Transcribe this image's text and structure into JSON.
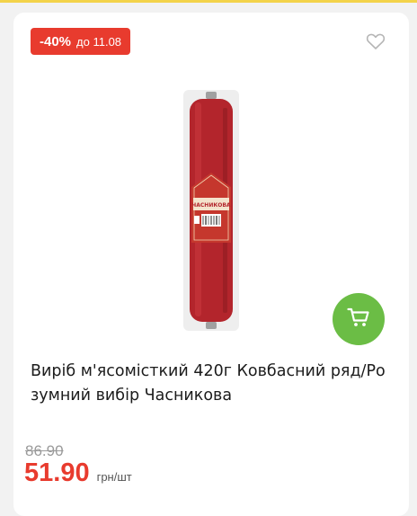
{
  "badge": {
    "discount": "-40%",
    "until": "до 11.08"
  },
  "icons": {
    "favorite": "heart-outline-icon",
    "cart": "cart-icon"
  },
  "product": {
    "title": "Виріб м'ясомісткий 420г Ковбасний ряд/Розумний вибір Часникова",
    "label_text": "ЧАСНИКОВА"
  },
  "price": {
    "old": "86.90",
    "current": "51.90",
    "unit": "грн/шт"
  },
  "colors": {
    "accent": "#e83b2e",
    "cart": "#6bbd45",
    "topbar": "#f3d34a"
  }
}
